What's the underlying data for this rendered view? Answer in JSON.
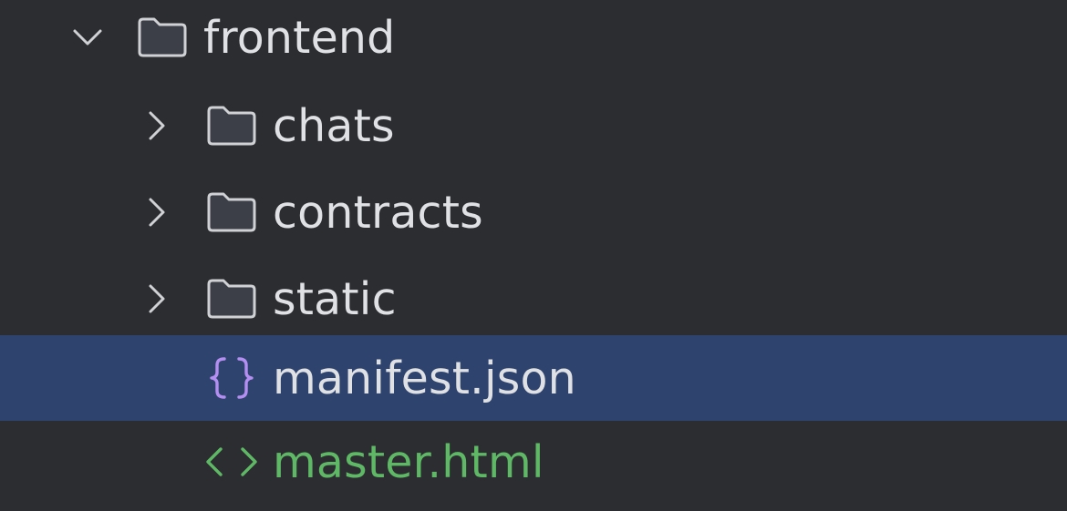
{
  "tree": {
    "root": {
      "label": "frontend",
      "expanded": true,
      "icon": "folder-icon"
    },
    "children": [
      {
        "label": "chats",
        "type": "folder",
        "expanded": false,
        "icon": "folder-icon"
      },
      {
        "label": "contracts",
        "type": "folder",
        "expanded": false,
        "icon": "folder-icon"
      },
      {
        "label": "static",
        "type": "folder",
        "expanded": false,
        "icon": "folder-icon"
      },
      {
        "label": "manifest.json",
        "type": "file",
        "selected": true,
        "icon": "json-braces-icon"
      },
      {
        "label": "master.html",
        "type": "file",
        "icon": "html-tag-icon"
      }
    ]
  },
  "colors": {
    "background": "#2b2d30",
    "selection": "#2e436e",
    "text": "#dfe1e5",
    "html_file_text": "#5fb865",
    "json_icon": "#b48ef0",
    "html_icon": "#5fb865",
    "folder_icon_stroke": "#cfd1d5",
    "chevron": "#cfd1d5"
  }
}
